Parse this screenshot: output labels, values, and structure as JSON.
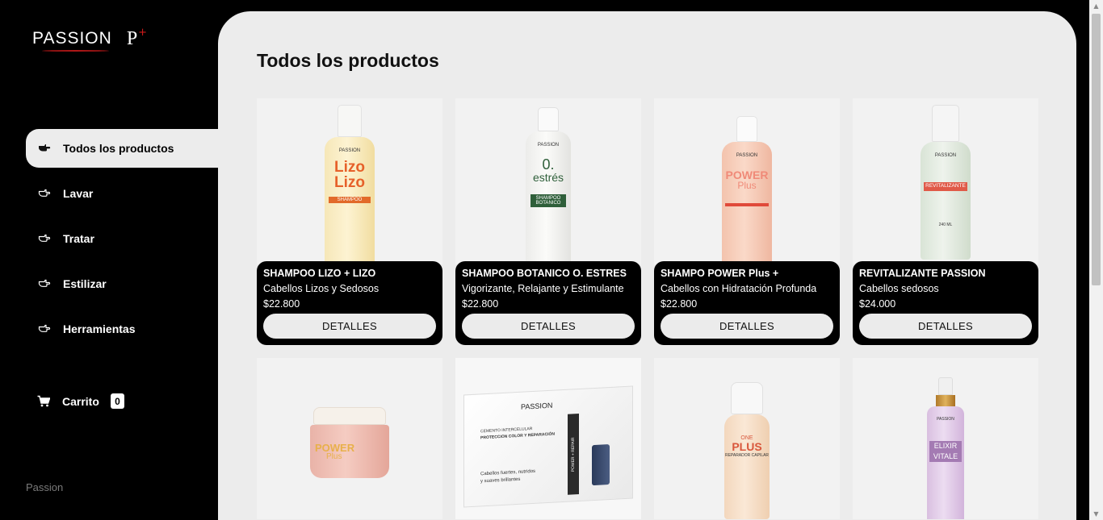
{
  "brand": {
    "logo_word": "PASSION",
    "logo_letter": "P",
    "logo_plus": "+",
    "footer": "Passion"
  },
  "nav": {
    "items": [
      {
        "label": "Todos los productos",
        "icon": "pointing-hand-icon",
        "active": true
      },
      {
        "label": "Lavar",
        "icon": "pointing-hand-outline-icon"
      },
      {
        "label": "Tratar",
        "icon": "pointing-hand-outline-icon"
      },
      {
        "label": "Estilizar",
        "icon": "pointing-hand-outline-icon"
      },
      {
        "label": "Herramientas",
        "icon": "pointing-hand-outline-icon"
      }
    ]
  },
  "cart": {
    "label": "Carrito",
    "count": "0",
    "icon": "cart-icon"
  },
  "main": {
    "title": "Todos los productos"
  },
  "products": [
    {
      "name": "SHAMPOO LIZO + LIZO",
      "desc": "Cabellos Lizos y Sedosos",
      "price": "$22.800",
      "button": "DETALLES",
      "bottle": {
        "brand": "PASSION",
        "line1": "Lizo",
        "line2": "Lizo",
        "sub": "SHAMPOO"
      }
    },
    {
      "name": "SHAMPOO BOTANICO O. ESTRES",
      "desc": "Vigorizante, Relajante y Estimulante",
      "price": "$22.800",
      "button": "DETALLES",
      "bottle": {
        "brand": "PASSION",
        "line1": "0.",
        "line2": "estrés",
        "sub": "SHAMPOO BOTANICO"
      }
    },
    {
      "name": "SHAMPO POWER Plus +",
      "desc": "Cabellos con Hidratación Profunda",
      "price": "$22.800",
      "button": "DETALLES",
      "bottle": {
        "brand": "PASSION",
        "line1": "POWER",
        "line2": "Plus",
        "sub": ""
      }
    },
    {
      "name": "REVITALIZANTE PASSION",
      "desc": "Cabellos sedosos",
      "price": "$24.000",
      "button": "DETALLES",
      "bottle": {
        "brand": "PASSION",
        "line1": "REVITALIZANTE",
        "line2": "",
        "sub": "240 ML"
      }
    }
  ],
  "products_row2": [
    {
      "label1": "POWER",
      "label2": "Plus"
    },
    {
      "brand": "PASSION",
      "side": "POWER + REPAIR",
      "line1": "CEMENTO INTERCELULAR",
      "line2": "PROTECCION COLOR Y REPARACIÓN",
      "line3": "Cabellos fuertes, nutridos",
      "line4": "y suaves brillantes"
    },
    {
      "label1": "ONE",
      "label2": "PLUS",
      "label3": "REPARADOR CAPILAR"
    },
    {
      "brand": "PASSION",
      "label1": "ELIXIR",
      "label2": "VITALE"
    }
  ],
  "colors": {
    "accent": "#d01a1a",
    "sidebar": "#000000",
    "main_bg": "#ececec",
    "card_info": "#000000",
    "button": "#ebebeb"
  }
}
